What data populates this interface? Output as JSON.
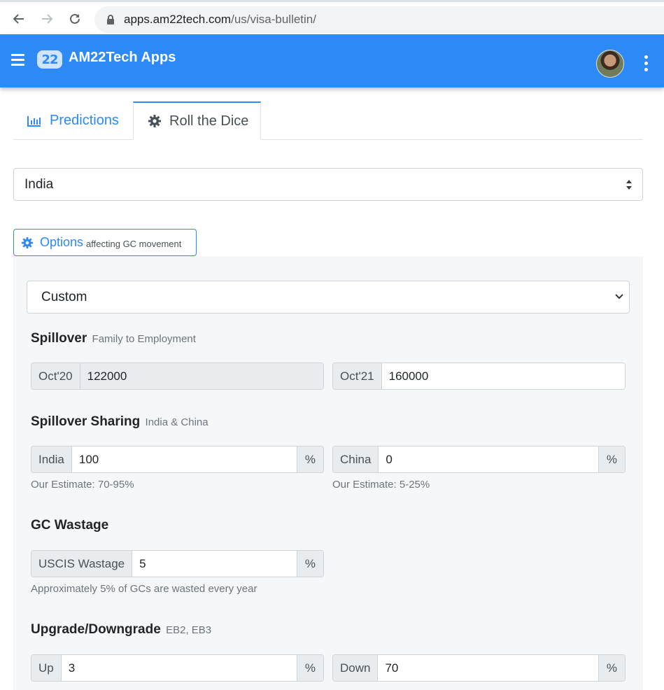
{
  "browser": {
    "url_host": "apps.am22tech.com",
    "url_path": "/us/visa-bulletin/"
  },
  "header": {
    "logo_text": "22",
    "app_title": "AM22Tech Apps"
  },
  "tabs": [
    {
      "label": "Predictions",
      "active": false
    },
    {
      "label": "Roll the Dice",
      "active": true
    }
  ],
  "country_select": {
    "value": "India"
  },
  "options_button": {
    "label": "Options",
    "sub": "affecting GC movement"
  },
  "panel": {
    "preset": {
      "value": "Custom"
    },
    "spillover": {
      "title": "Spillover",
      "subtitle": "Family to Employment",
      "left": {
        "addon": "Oct'20",
        "value": "122000",
        "readonly": true
      },
      "right": {
        "addon": "Oct'21",
        "value": "160000"
      }
    },
    "sharing": {
      "title": "Spillover Sharing",
      "subtitle": "India & China",
      "left": {
        "addon": "India",
        "value": "100",
        "unit": "%",
        "help": "Our Estimate: 70-95%"
      },
      "right": {
        "addon": "China",
        "value": "0",
        "unit": "%",
        "help": "Our Estimate: 5-25%"
      }
    },
    "wastage": {
      "title": "GC Wastage",
      "field": {
        "addon": "USCIS Wastage",
        "value": "5",
        "unit": "%"
      },
      "help": "Approximately 5% of GCs are wasted every year"
    },
    "upgrade": {
      "title": "Upgrade/Downgrade",
      "subtitle": "EB2, EB3",
      "left": {
        "addon": "Up",
        "value": "3",
        "unit": "%"
      },
      "right": {
        "addon": "Down",
        "value": "70",
        "unit": "%"
      }
    }
  },
  "colors": {
    "brand": "#2d89f5",
    "panel_bg": "#f6f7f9"
  }
}
